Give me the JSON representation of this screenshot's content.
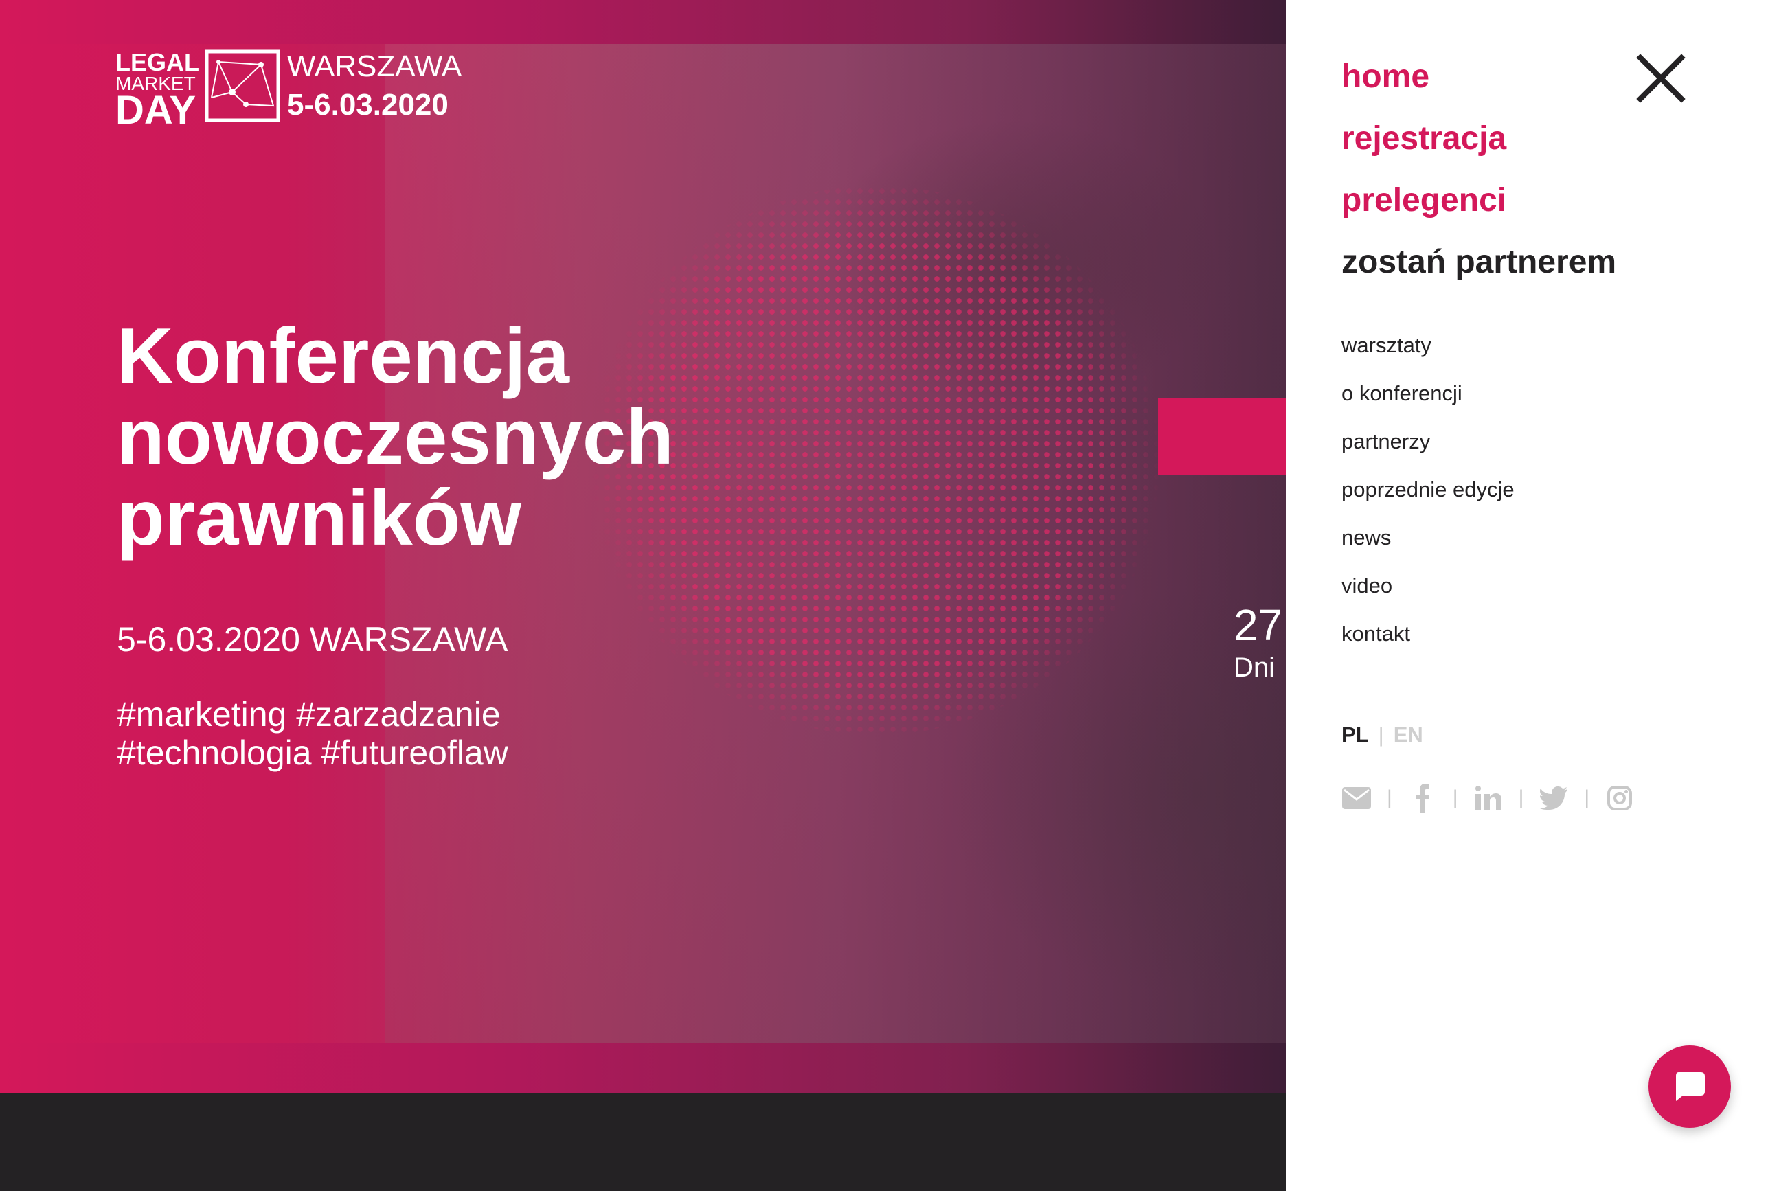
{
  "logo": {
    "line1": "LEGAL",
    "line2": "MARKET",
    "line3": "DAY",
    "city": "WARSZAWA",
    "date": "5-6.03.2020"
  },
  "hero": {
    "headline": "Konferencja nowoczesnych prawników",
    "subline": "5-6.03.2020 WARSZAWA",
    "tags": "#marketing #zarzadzanie #technologia #futureoflaw"
  },
  "countdown": {
    "value": "27",
    "unit": "Dni"
  },
  "menu": {
    "primary": [
      "home",
      "rejestracja",
      "prelegenci",
      "zostań partnerem"
    ],
    "secondary": [
      "warsztaty",
      "o konferencji",
      "partnerzy",
      "poprzednie edycje",
      "news",
      "video",
      "kontakt"
    ],
    "lang_active": "PL",
    "lang_separator": "|",
    "lang_other": "EN",
    "social_icons": [
      "envelope-icon",
      "facebook-icon",
      "linkedin-icon",
      "twitter-icon",
      "instagram-icon"
    ]
  },
  "colors": {
    "accent": "#d4185a",
    "dark": "#242224",
    "muted": "#cfcfcf"
  }
}
